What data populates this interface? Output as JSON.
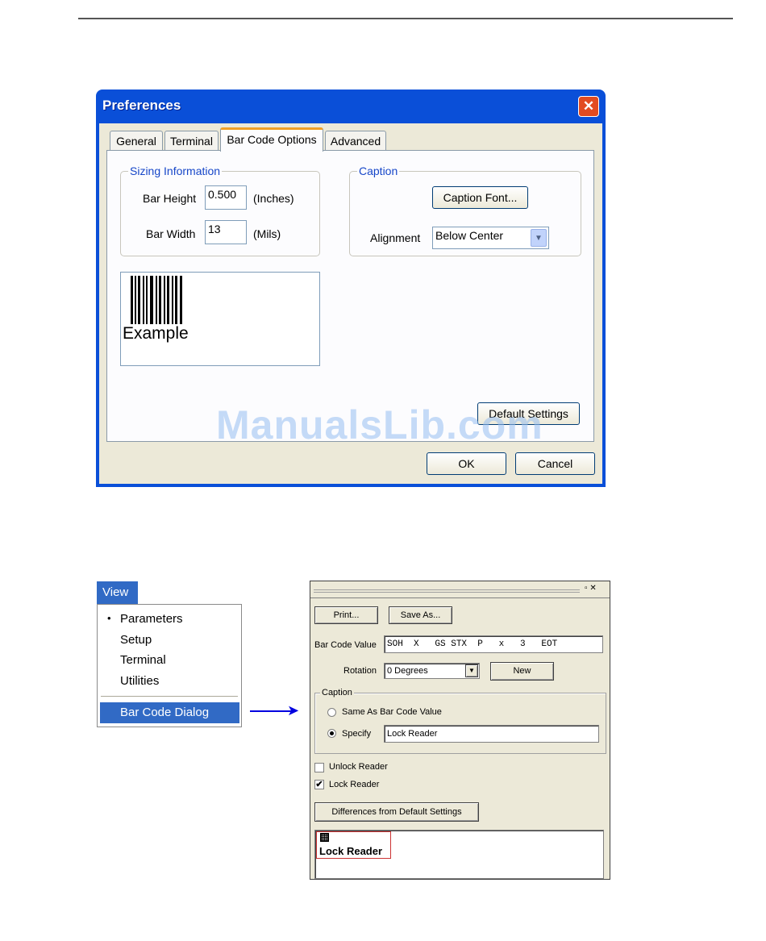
{
  "preferences": {
    "title": "Preferences",
    "close_icon_glyph": "✕",
    "tabs": [
      {
        "label": "General"
      },
      {
        "label": "Terminal"
      },
      {
        "label": "Bar Code Options"
      },
      {
        "label": "Advanced"
      }
    ],
    "active_tab": "Bar Code Options",
    "sizing": {
      "group_label": "Sizing Information",
      "bar_height_label": "Bar Height",
      "bar_height_value": "0.500",
      "bar_height_unit": "(Inches)",
      "bar_width_label": "Bar Width",
      "bar_width_value": "13",
      "bar_width_unit": "(Mils)"
    },
    "caption": {
      "group_label": "Caption",
      "font_button": "Caption Font...",
      "alignment_label": "Alignment",
      "alignment_value": "Below Center"
    },
    "preview_text": "Example",
    "default_settings_button": "Default Settings",
    "ok_button": "OK",
    "cancel_button": "Cancel",
    "watermark": "ManualsLib.com"
  },
  "view_menu": {
    "title": "View",
    "items": [
      {
        "label": "Parameters",
        "checked": true
      },
      {
        "label": "Setup"
      },
      {
        "label": "Terminal"
      },
      {
        "label": "Utilities"
      },
      {
        "label": "Bar Code Dialog",
        "selected": true
      }
    ],
    "bullet": "•"
  },
  "barcode_dialog": {
    "window_controls": "▫ ✕",
    "print_button": "Print...",
    "save_as_button": "Save As...",
    "value_label": "Bar Code Value",
    "value": "SOH  X   GS STX  P   x   3   EOT",
    "rotation_label": "Rotation",
    "rotation_value": "0 Degrees",
    "new_button": "New",
    "caption_group_label": "Caption",
    "radio_same": "Same As Bar Code Value",
    "radio_specify": "Specify",
    "specify_value": "Lock Reader",
    "unlock_checkbox": "Unlock Reader",
    "lock_checkbox": "Lock Reader",
    "lock_checked": true,
    "diff_button": "Differences from Default Settings",
    "preview_caption": "Lock Reader",
    "check_glyph": "✔",
    "dropdown_glyph": "▼"
  },
  "arrow_glyph": "➤"
}
